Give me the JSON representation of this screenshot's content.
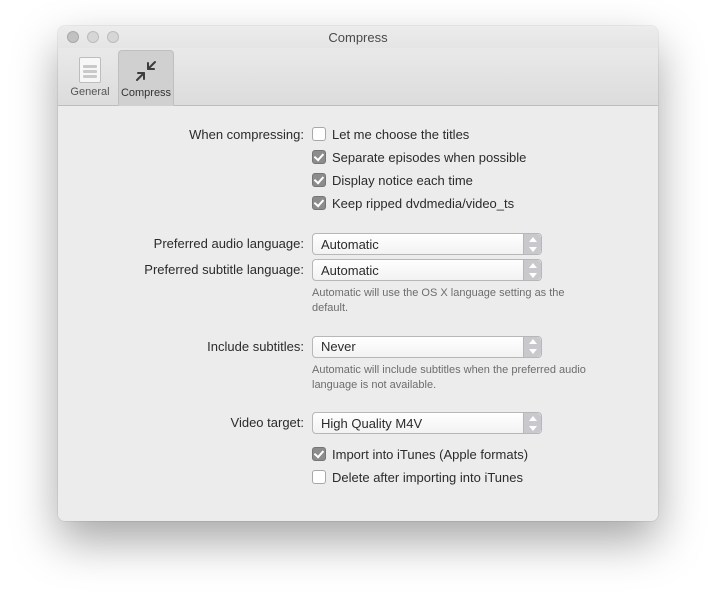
{
  "window": {
    "title": "Compress"
  },
  "toolbar": {
    "general": "General",
    "compress": "Compress",
    "selected": "compress"
  },
  "form": {
    "when_compressing": {
      "label": "When compressing:",
      "opt_choose_titles": {
        "label": "Let me choose the titles",
        "checked": false
      },
      "opt_separate": {
        "label": "Separate episodes when possible",
        "checked": true
      },
      "opt_notice": {
        "label": "Display notice each time",
        "checked": true
      },
      "opt_keep_ripped": {
        "label": "Keep ripped dvdmedia/video_ts",
        "checked": true
      }
    },
    "audio_lang": {
      "label": "Preferred audio language:",
      "value": "Automatic"
    },
    "subtitle_lang": {
      "label": "Preferred subtitle language:",
      "value": "Automatic",
      "hint": "Automatic will use the OS X language setting as the default."
    },
    "include_subtitles": {
      "label": "Include subtitles:",
      "value": "Never",
      "hint": "Automatic will include subtitles when the preferred audio language is not available."
    },
    "video_target": {
      "label": "Video target:",
      "value": "High Quality M4V",
      "opt_import_itunes": {
        "label": "Import into iTunes (Apple formats)",
        "checked": true
      },
      "opt_delete_after": {
        "label": "Delete after importing into iTunes",
        "checked": false
      }
    }
  }
}
